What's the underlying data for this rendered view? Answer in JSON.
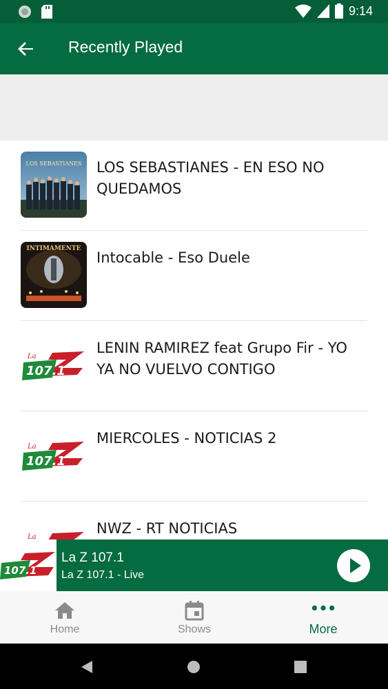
{
  "status_bar": {
    "time": "9:14",
    "icons": [
      "sync-icon",
      "sd-card-icon",
      "wifi-icon",
      "signal-icon",
      "battery-icon"
    ]
  },
  "app_bar": {
    "title": "Recently Played",
    "back_icon": "arrow-back-icon"
  },
  "recently_played": [
    {
      "title": "LOS SEBASTIANES - EN ESO NO QUEDAMOS",
      "art": "album-art-los-sebastianes"
    },
    {
      "title": "Intocable - Eso Duele",
      "art": "album-art-intimamente"
    },
    {
      "title": "LENIN RAMIREZ feat Grupo Fir - YO YA NO VUELVO CONTIGO",
      "art": "la-z-107-logo"
    },
    {
      "title": "MIERCOLES - NOTICIAS 2",
      "art": "la-z-107-logo"
    },
    {
      "title": "NWZ - RT NOTICIAS",
      "art": "la-z-107-logo"
    }
  ],
  "mini_player": {
    "title": "La Z 107.1",
    "subtitle": "La Z 107.1 - Live",
    "art": "la-z-107-logo",
    "logo_text": "107.1"
  },
  "bottom_nav": [
    {
      "label": "Home",
      "icon": "home-icon",
      "active": false
    },
    {
      "label": "Shows",
      "icon": "calendar-icon",
      "active": false
    },
    {
      "label": "More",
      "icon": "more-dots-icon",
      "active": true
    }
  ],
  "colors": {
    "status_bar": "#055e38",
    "primary": "#056b40",
    "logo_red": "#c8202b",
    "logo_green": "#1e8a3a",
    "nav_inactive": "#8a8a8a"
  }
}
